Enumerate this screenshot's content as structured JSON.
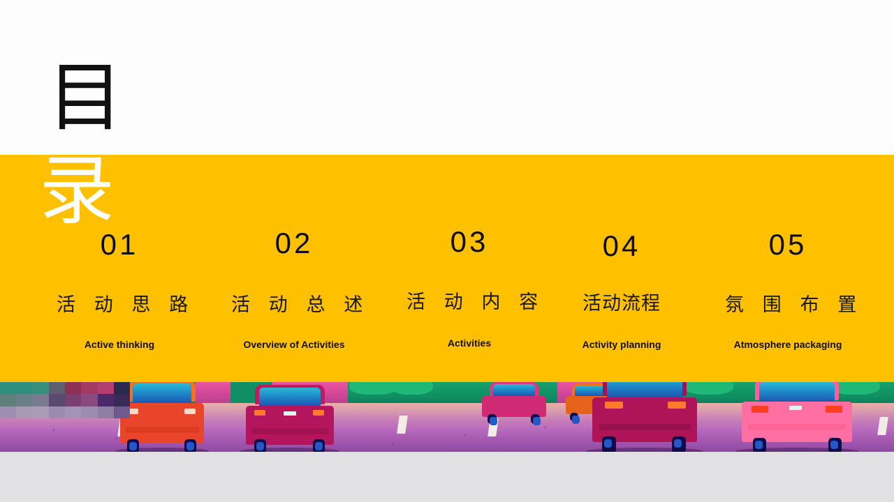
{
  "slide": {
    "title_top_char": "目",
    "title_bottom_char": "录",
    "band_color": "#FFC000",
    "title_top_color": "#111111",
    "title_bottom_color": "#FFFFFF",
    "page_background": "#E1E1E3"
  },
  "toc": {
    "items": [
      {
        "number": "01",
        "title_cn": "活 动 思 路",
        "title_en": "Active thinking"
      },
      {
        "number": "02",
        "title_cn": "活 动 总 述",
        "title_en": "Overview of Activities"
      },
      {
        "number": "03",
        "title_cn": "活 动 内 容",
        "title_en": "Activities"
      },
      {
        "number": "04",
        "title_cn": "活动流程",
        "title_en": "Activity planning"
      },
      {
        "number": "05",
        "title_cn": "氛 围 布 置",
        "title_en": "Atmosphere packaging"
      }
    ]
  },
  "illustration": {
    "name": "cars-on-road-illustration",
    "road_colors": [
      "#E8B0A0",
      "#C983B6",
      "#8E4AA2"
    ],
    "hedge_color": "#0F8F63",
    "sky_color": "#D94B9A",
    "car_colors": [
      "#E8452B",
      "#C21A62",
      "#AE1457",
      "#FF5E96",
      "#F2711C"
    ],
    "mosaic_tiles": [
      "#2f8f7e",
      "#2f8f7e",
      "#3a8f7a",
      "#5d5f70",
      "#8e2f55",
      "#a33a62",
      "#b03f6e",
      "#2a2a4e",
      "#5f7f7a",
      "#6a7f8a",
      "#7a7a90",
      "#5a4a72",
      "#7a3f72",
      "#8a4a80",
      "#4a2a6a",
      "#3a2a58",
      "#9f8fae",
      "#a79ab5",
      "#a89cb8",
      "#9a8cae",
      "#a393b4",
      "#9c8cae",
      "#8e7ea4",
      "#6e5a8c"
    ]
  }
}
